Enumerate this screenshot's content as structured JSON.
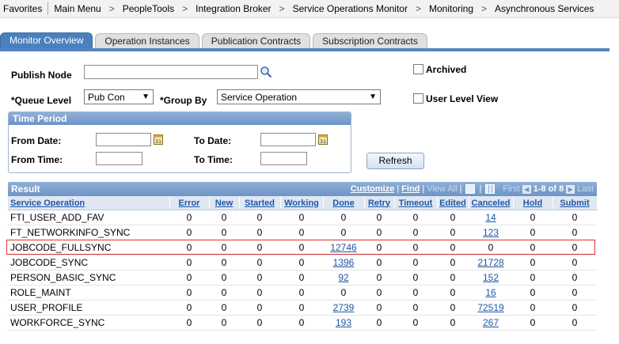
{
  "breadcrumbs": [
    "Favorites",
    "Main Menu",
    "PeopleTools",
    "Integration Broker",
    "Service Operations Monitor",
    "Monitoring",
    "Asynchronous Services"
  ],
  "tabs": [
    {
      "label": "Monitor Overview",
      "active": true
    },
    {
      "label": "Operation Instances",
      "active": false
    },
    {
      "label": "Publication Contracts",
      "active": false
    },
    {
      "label": "Subscription Contracts",
      "active": false
    }
  ],
  "form": {
    "publish_node_label": "Publish Node",
    "publish_node_value": "",
    "queue_level_label": "*Queue Level",
    "queue_level_value": "Pub Con",
    "group_by_label": "*Group By",
    "group_by_value": "Service Operation",
    "archived_label": "Archived",
    "user_level_view_label": "User Level View",
    "time_period_title": "Time Period",
    "from_date_label": "From Date:",
    "to_date_label": "To Date:",
    "from_time_label": "From Time:",
    "to_time_label": "To Time:",
    "refresh_label": "Refresh"
  },
  "result": {
    "title": "Result",
    "customize": "Customize",
    "find": "Find",
    "view_all": "View All",
    "first": "First",
    "range": "1-8 of 8",
    "last": "Last",
    "columns": [
      "Service Operation",
      "Error",
      "New",
      "Started",
      "Working",
      "Done",
      "Retry",
      "Timeout",
      "Edited",
      "Canceled",
      "Hold",
      "Submit"
    ],
    "rows": [
      [
        "FTI_USER_ADD_FAV",
        "0",
        "0",
        "0",
        "0",
        "0",
        "0",
        "0",
        "0",
        "14",
        "0",
        "0"
      ],
      [
        "FT_NETWORKINFO_SYNC",
        "0",
        "0",
        "0",
        "0",
        "0",
        "0",
        "0",
        "0",
        "123",
        "0",
        "0"
      ],
      [
        "JOBCODE_FULLSYNC",
        "0",
        "0",
        "0",
        "0",
        "12746",
        "0",
        "0",
        "0",
        "0",
        "0",
        "0"
      ],
      [
        "JOBCODE_SYNC",
        "0",
        "0",
        "0",
        "0",
        "1396",
        "0",
        "0",
        "0",
        "21728",
        "0",
        "0"
      ],
      [
        "PERSON_BASIC_SYNC",
        "0",
        "0",
        "0",
        "0",
        "92",
        "0",
        "0",
        "0",
        "152",
        "0",
        "0"
      ],
      [
        "ROLE_MAINT",
        "0",
        "0",
        "0",
        "0",
        "0",
        "0",
        "0",
        "0",
        "16",
        "0",
        "0"
      ],
      [
        "USER_PROFILE",
        "0",
        "0",
        "0",
        "0",
        "2739",
        "0",
        "0",
        "0",
        "72519",
        "0",
        "0"
      ],
      [
        "WORKFORCE_SYNC",
        "0",
        "0",
        "0",
        "0",
        "193",
        "0",
        "0",
        "0",
        "267",
        "0",
        "0"
      ]
    ],
    "highlighted_row": 2,
    "highlight_color": "#dd3333"
  },
  "icons": {
    "lookup": "magnifier-icon",
    "calendar": "calendar-icon",
    "download": "download-icon",
    "grid_view": "grid-view-icon"
  },
  "colors": {
    "accent": "#4b80be",
    "header_gradient_top": "#8fb0d8",
    "header_gradient_bottom": "#6e94c6",
    "link": "#1f57a6"
  }
}
